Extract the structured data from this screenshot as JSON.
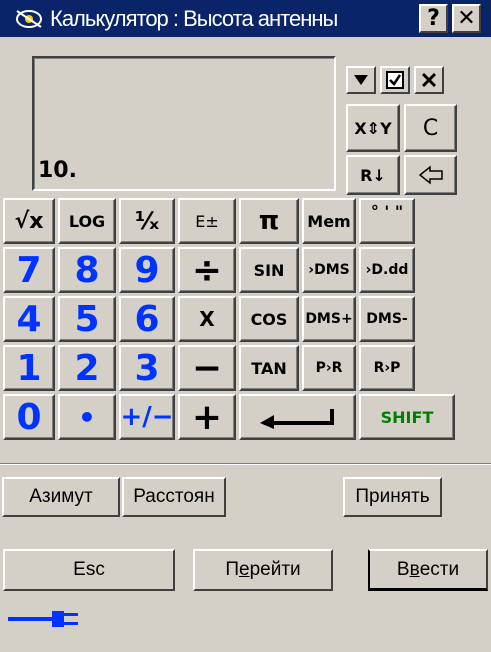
{
  "window": {
    "title": "Калькулятор : Высота антенны",
    "help_label": "?",
    "close_label": "✕"
  },
  "display": {
    "value": "10."
  },
  "top_controls": {
    "dropdown_icon": "chevron-down-icon",
    "check_icon": "checkbox-icon",
    "close_icon": "close-icon",
    "swap_label": "X⇕Y",
    "clear_label": "C",
    "roll_label": "R↓",
    "backspace_icon": "backspace-arrow-icon"
  },
  "keys": {
    "sqrt": "√x",
    "log": "LOG",
    "recip": "¹⁄ₓ",
    "exp": "E±",
    "pi": "π",
    "mem": "Mem",
    "dms_symbols": "° ' \"",
    "n7": "7",
    "n8": "8",
    "n9": "9",
    "div": "÷",
    "sin": "SIN",
    "to_dms": "›DMS",
    "to_ddd": "›D.dd",
    "n4": "4",
    "n5": "5",
    "n6": "6",
    "mul": "X",
    "cos": "COS",
    "dms_plus": "DMS+",
    "dms_minus": "DMS-",
    "n1": "1",
    "n2": "2",
    "n3": "3",
    "minus": "−",
    "tan": "TAN",
    "p2r": "P›R",
    "r2p": "R›P",
    "n0": "0",
    "dot": "•",
    "sign": "+∕−",
    "plus": "+",
    "enter_icon": "enter-arrow-icon",
    "shift": "SHIFT"
  },
  "tabs": {
    "azimuth": "Азимут",
    "distance": "Расстоян",
    "accept": "Принять"
  },
  "actions": {
    "esc": "Esc",
    "goto_prefix": "П",
    "goto_underline": "е",
    "goto_suffix": "рейти",
    "enter_prefix": "В",
    "enter_underline": "в",
    "enter_suffix": "ести"
  },
  "status": {
    "connection_icon": "power-plug-icon"
  },
  "colors": {
    "titlebar": "#0a246a",
    "face": "#d4d0c8",
    "digit_blue": "#0033ff",
    "shift_green": "#008000"
  }
}
